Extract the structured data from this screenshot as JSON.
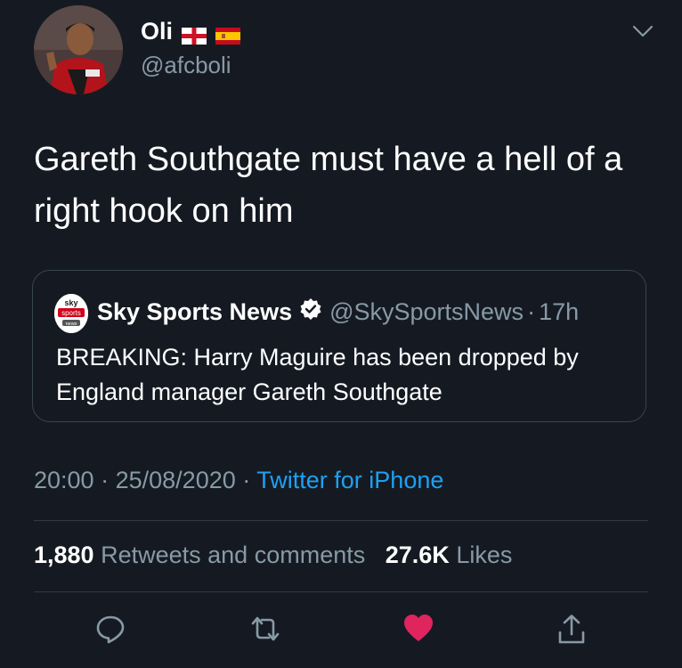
{
  "author": {
    "name": "Oli",
    "handle": "@afcboli",
    "flags": [
      "england-flag-icon",
      "spain-flag-icon"
    ]
  },
  "tweet": {
    "text": "Gareth Southgate must have a hell of a right hook on him"
  },
  "quoted_tweet": {
    "name": "Sky Sports News",
    "handle": "@SkySportsNews",
    "separator": "·",
    "age": "17h",
    "text": "BREAKING: Harry Maguire has been dropped by England manager Gareth Southgate",
    "logo_text": [
      "sky",
      "sports",
      "news"
    ]
  },
  "meta": {
    "time": "20:00",
    "separator": "·",
    "date": "25/08/2020",
    "source": "Twitter for iPhone"
  },
  "stats": {
    "retweets_count": "1,880",
    "retweets_label": "Retweets and comments",
    "likes_count": "27.6K",
    "likes_label": "Likes"
  },
  "actions": [
    "reply-icon",
    "retweet-icon",
    "like-icon",
    "share-icon"
  ],
  "colors": {
    "background": "#151a22",
    "secondary_text": "#8899a6",
    "link": "#1da1f2",
    "like": "#e0245e",
    "border": "#38444d"
  }
}
